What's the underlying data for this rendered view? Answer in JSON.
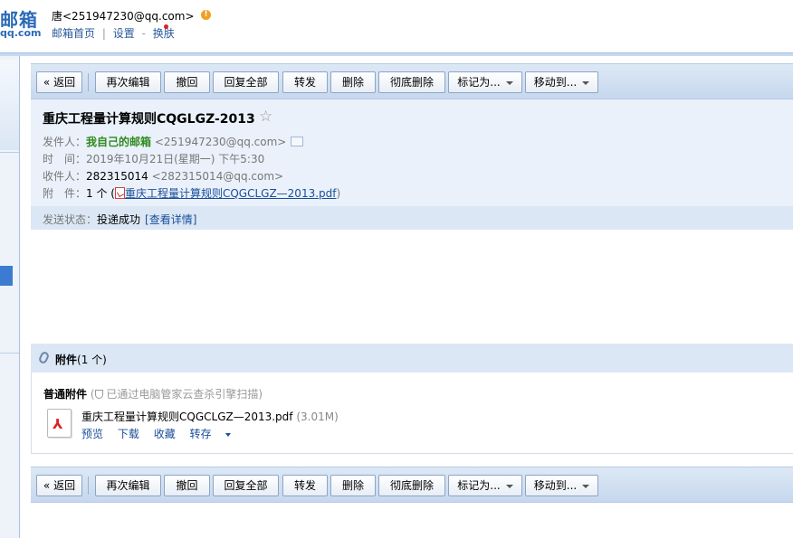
{
  "brand": {
    "logo_cn": "邮箱",
    "logo_en": "qq.com"
  },
  "user": {
    "display": "唐<251947230@qq.com>"
  },
  "toplinks": {
    "home": "邮箱首页",
    "sep": "|",
    "settings": "设置",
    "dash": "-",
    "skin": "换肤"
  },
  "toolbar": {
    "back": "« 返回",
    "reedit": "再次编辑",
    "recall": "撤回",
    "reply_all": "回复全部",
    "forward": "转发",
    "delete": "删除",
    "purge": "彻底删除",
    "mark_as": "标记为...",
    "move_to": "移动到..."
  },
  "mail": {
    "subject": "重庆工程量计算规则CQGLGZ-2013",
    "from_label": "发件人：",
    "from_name": "我自己的邮箱",
    "from_addr": "<251947230@qq.com>",
    "time_label": "时　间：",
    "time_value": "2019年10月21日(星期一) 下午5:30",
    "to_label": "收件人：",
    "to_name": "282315014",
    "to_addr": "<282315014@qq.com>",
    "attach_label": "附　件：",
    "attach_count": "1 个 (",
    "attach_link": "重庆工程量计算规则CQGCLGZ—2013.pdf",
    "attach_close": ")",
    "status_label": "发送状态：",
    "status_value": "投递成功",
    "status_link": "[查看详情]"
  },
  "attachments": {
    "title": "附件",
    "count": "(1 个)",
    "normal_label": "普通附件",
    "scan_open": "(",
    "scan_text": "已通过电脑管家云查杀引擎扫描)",
    "file_name": "重庆工程量计算规则CQGCLGZ—2013.pdf",
    "file_size": "(3.01M)",
    "actions": {
      "preview": "预览",
      "download": "下载",
      "favorite": "收藏",
      "save_to": "转存"
    }
  },
  "icons": [
    "warning-icon",
    "star-icon",
    "contact-card-icon",
    "pdf-icon",
    "paperclip-icon",
    "shield-icon",
    "dropdown-arrow-icon"
  ],
  "colors": {
    "accent": "#2a6ab8",
    "link": "#1a4e9a",
    "sender_green": "#2e8a1e",
    "toolbar_bg": "#c6d8ee",
    "header_bg": "#eaf1fa"
  }
}
